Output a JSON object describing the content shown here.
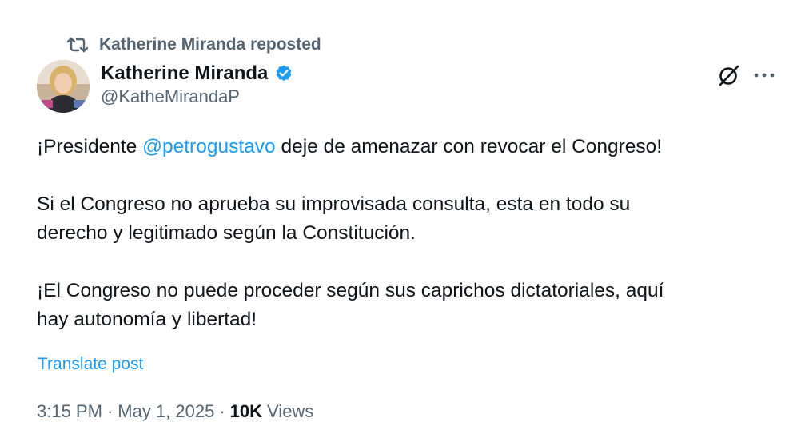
{
  "repost": {
    "text": "Katherine Miranda reposted",
    "icon": "repost-icon"
  },
  "author": {
    "name": "Katherine Miranda",
    "handle": "@KatheMirandaP",
    "verified": true,
    "verified_color": "#1d9bf0",
    "avatar_icon": "avatar"
  },
  "header_actions": {
    "grok_icon": "grok-icon",
    "more_icon": "more-icon"
  },
  "tweet": {
    "line1_prefix": "¡Presidente ",
    "mention": "@petrogustavo",
    "line1_suffix": " deje de amenazar con revocar el Congreso!",
    "para2_line1": "Si el Congreso no aprueba su improvisada consulta, esta en todo su",
    "para2_line2": "derecho y legitimado según la Constitución.",
    "para3_line1": "¡El Congreso no puede proceder según sus caprichos dictatoriales, aquí",
    "para3_line2": "hay autonomía y libertad!"
  },
  "translate_label": "Translate post",
  "meta": {
    "time": "3:15 PM",
    "separator": "·",
    "date": "May 1, 2025",
    "views_count": "10K",
    "views_label": "Views"
  },
  "colors": {
    "text": "#0f1419",
    "secondary": "#536471",
    "link": "#1d9bf0"
  }
}
